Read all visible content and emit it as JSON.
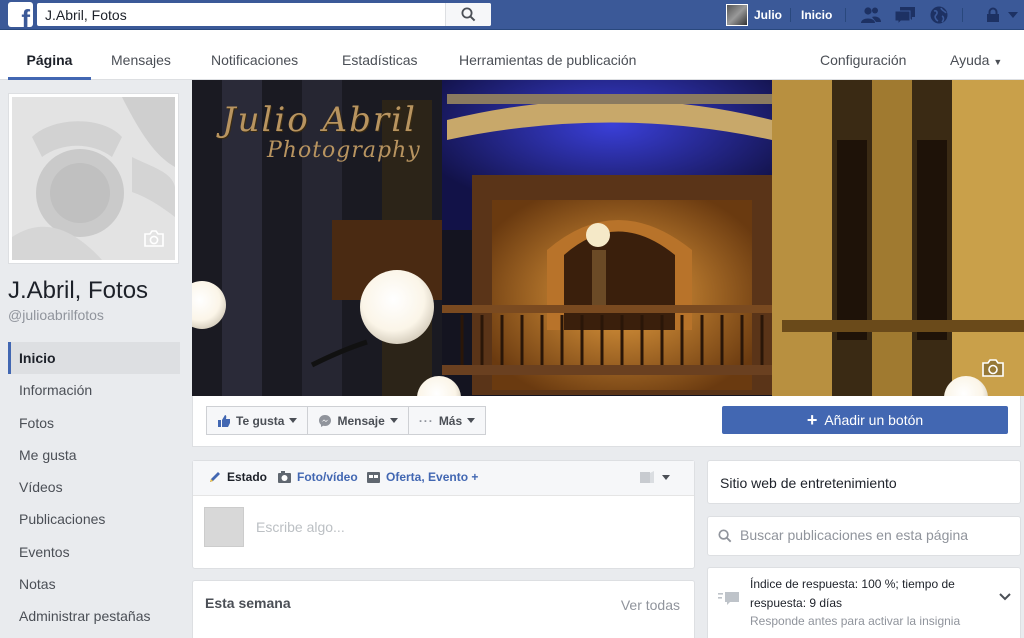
{
  "topbar": {
    "search_value": "J.Abril, Fotos",
    "user_name": "Julio",
    "home_label": "Inicio",
    "icons": [
      "friends-icon",
      "messages-icon",
      "globe-icon",
      "lock-icon"
    ]
  },
  "page_nav": {
    "tabs": [
      {
        "label": "Página",
        "active": true
      },
      {
        "label": "Mensajes"
      },
      {
        "label": "Notificaciones"
      },
      {
        "label": "Estadísticas"
      },
      {
        "label": "Herramientas de publicación"
      },
      {
        "label": "Configuración"
      },
      {
        "label": "Ayuda"
      }
    ]
  },
  "page": {
    "name": "J.Abril, Fotos",
    "handle": "@julioabrilfotos"
  },
  "cover": {
    "watermark_title": "Julio Abril",
    "watermark_subtitle": "Photography"
  },
  "sidebar": {
    "items": [
      {
        "label": "Inicio",
        "active": true
      },
      {
        "label": "Información"
      },
      {
        "label": "Fotos"
      },
      {
        "label": "Me gusta"
      },
      {
        "label": "Vídeos"
      },
      {
        "label": "Publicaciones"
      },
      {
        "label": "Eventos"
      },
      {
        "label": "Notas"
      },
      {
        "label": "Administrar pestañas"
      }
    ]
  },
  "actions": {
    "like": "Te gusta",
    "message": "Mensaje",
    "more": "Más",
    "add_button": "Añadir un botón"
  },
  "composer": {
    "tab_status": "Estado",
    "tab_photo": "Foto/vídeo",
    "tab_offer": "Oferta, Evento +",
    "placeholder": "Escribe algo..."
  },
  "week": {
    "title": "Esta semana",
    "link": "Ver todas"
  },
  "right": {
    "category": "Sitio web de entretenimiento",
    "search_placeholder": "Buscar publicaciones en esta página",
    "response_text": "Índice de respuesta: 100 %; tiempo de respuesta: 9 días",
    "response_sub": "Responde antes para activar la insignia"
  },
  "colors": {
    "brand": "#3b5998",
    "accent": "#4267b2"
  }
}
